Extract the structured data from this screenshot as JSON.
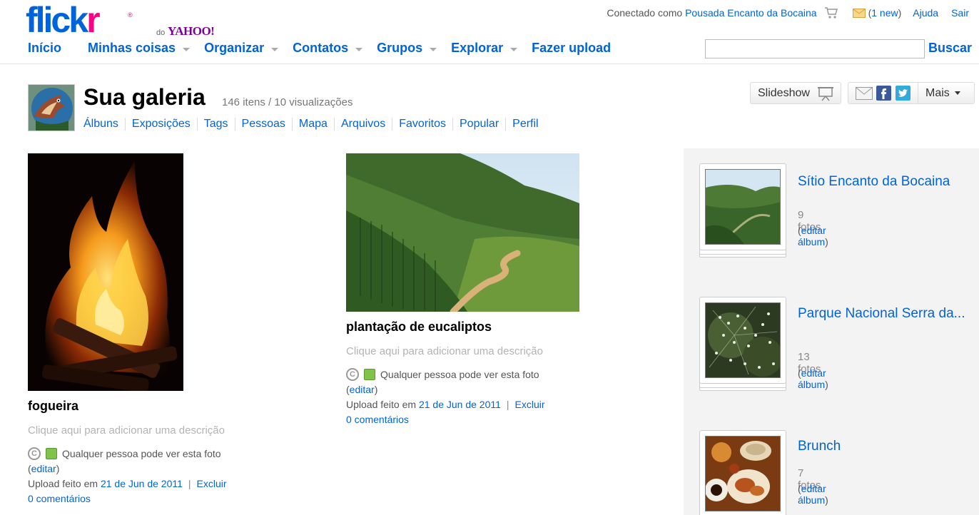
{
  "header": {
    "logo_text_blue": "flick",
    "logo_text_pink": "r",
    "logo_reg": "®",
    "logo_do": "do",
    "logo_yahoo": "YAHOO!",
    "connected_prefix": "Conectado como",
    "username": "Pousada Encanto da Bocaina",
    "mail_count": "1 new",
    "help": "Ajuda",
    "signout": "Sair",
    "search_value": "",
    "search_button": "Buscar"
  },
  "nav": {
    "items": [
      {
        "label": "Início"
      },
      {
        "label": "Minhas coisas"
      },
      {
        "label": "Organizar"
      },
      {
        "label": "Contatos"
      },
      {
        "label": "Grupos"
      },
      {
        "label": "Explorar"
      },
      {
        "label": "Fazer upload"
      }
    ]
  },
  "gallery": {
    "title": "Sua galeria",
    "stats": "146 itens / 10 visualizações",
    "subnav": [
      "Álbuns",
      "Exposições",
      "Tags",
      "Pessoas",
      "Mapa",
      "Arquivos",
      "Favoritos",
      "Popular",
      "Perfil"
    ],
    "slideshow": "Slideshow",
    "more": "Mais"
  },
  "photos": [
    {
      "title": "fogueira",
      "description_placeholder": "Clique aqui para adicionar uma descrição",
      "privacy": "Qualquer pessoa pode ver esta foto",
      "edit": "editar",
      "upload_prefix": "Upload feito em",
      "upload_date": "21 de Jun de 2011",
      "delete": "Excluir",
      "comments": "0 comentários"
    },
    {
      "title": "plantação de eucaliptos",
      "description_placeholder": "Clique aqui para adicionar uma descrição",
      "privacy": "Qualquer pessoa pode ver esta foto",
      "edit": "editar",
      "upload_prefix": "Upload feito em",
      "upload_date": "21 de Jun de 2011",
      "delete": "Excluir",
      "comments": "0 comentários"
    }
  ],
  "albums": [
    {
      "title": "Sítio Encanto da Bocaina",
      "count": "9 fotos",
      "edit": "editar álbum"
    },
    {
      "title": "Parque Nacional Serra da...",
      "count": "13 fotos",
      "edit": "editar álbum"
    },
    {
      "title": "Brunch",
      "count": "7 fotos",
      "edit": "editar álbum"
    }
  ],
  "colors": {
    "link": "#0063dc",
    "brand_pink": "#ff0084",
    "yahoo_purple": "#7b0099",
    "sidebar_bg": "#f3f3f3"
  }
}
